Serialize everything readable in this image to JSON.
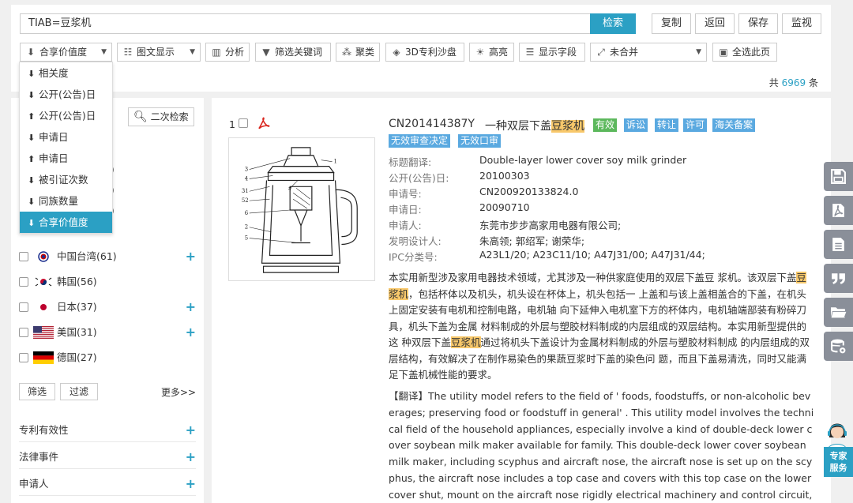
{
  "search": {
    "query": "TIAB=豆浆机",
    "button": "检索"
  },
  "top_buttons": [
    "复制",
    "返回",
    "保存",
    "监视"
  ],
  "toolbar": {
    "sort": "合享价值度",
    "display": "图文显示",
    "analyze": "分析",
    "filter_keywords": "筛选关键词",
    "cluster": "聚类",
    "sandbox": "3D专利沙盘",
    "highlight": "高亮",
    "fields": "显示字段",
    "merge": "未合并",
    "select_all": "全选此页"
  },
  "total": {
    "prefix": "共",
    "count": "6969",
    "suffix": "条"
  },
  "sort_options": [
    {
      "label": "相关度",
      "dir": "down"
    },
    {
      "label": "公开(公告)日",
      "dir": "down"
    },
    {
      "label": "公开(公告)日",
      "dir": "up"
    },
    {
      "label": "申请日",
      "dir": "down"
    },
    {
      "label": "申请日",
      "dir": "up"
    },
    {
      "label": "被引证次数",
      "dir": "down"
    },
    {
      "label": "同族数量",
      "dir": "down"
    },
    {
      "label": "合享价值度",
      "dir": "down",
      "active": true
    }
  ],
  "left": {
    "second_search": "二次检索",
    "hidden_counts": [
      ")",
      ")",
      ")"
    ],
    "countries": [
      {
        "label": "中国台湾(61)",
        "plus": true
      },
      {
        "label": "韩国(56)",
        "plus": false
      },
      {
        "label": "日本(37)",
        "plus": true
      },
      {
        "label": "美国(31)",
        "plus": true
      },
      {
        "label": "德国(27)",
        "plus": false
      }
    ],
    "filter_btn": "筛选",
    "exclude_btn": "过滤",
    "more": "更多>>",
    "sections": [
      "专利有效性",
      "法律事件",
      "申请人"
    ]
  },
  "record": {
    "index": "1",
    "pub_no": "CN201414387Y",
    "title_prefix": "一种双层下盖",
    "title_hl": "豆浆机",
    "tags_row1": [
      "有效",
      "诉讼",
      "转让",
      "许可",
      "海关备案"
    ],
    "tags_row2": [
      "无效审查决定",
      "无效口审"
    ],
    "fields": [
      {
        "label": "标题翻译:",
        "value": "Double-layer lower cover soy milk grinder"
      },
      {
        "label": "公开(公告)日:",
        "value": "20100303"
      },
      {
        "label": "申请号:",
        "value": "CN200920133824.0"
      },
      {
        "label": "申请日:",
        "value": "20090710"
      },
      {
        "label": "申请人:",
        "value": "东莞市步步高家用电器有限公司;"
      },
      {
        "label": "发明设计人:",
        "value": "朱高领; 郭绍军; 谢荣华;"
      },
      {
        "label": "IPC分类号:",
        "value": "A23L1/20; A23C11/10; A47J31/00; A47J31/44;"
      }
    ],
    "abstract_parts": [
      "本实用新型涉及家用电器技术领域，尤其涉及一种供家庭使用的双层下盖豆 浆机。该双层下盖",
      "豆浆机",
      "，包括杯体以及机头，机头设在杯体上，机头包括一 上盖和与该上盖相盖合的下盖，在机头上固定安装有电机和控制电路，电机轴 向下延伸入电机室下方的杯体内，电机轴端部装有粉碎刀具，机头下盖为金属 材料制成的外层与塑胶材料制成的内层组成的双层结构。本实用新型提供的这 种双层下盖",
      "豆浆机",
      "通过将机头下盖设计为金属材料制成的外层与塑胶材料制成 的内层组成的双层结构，有效解决了在制作易染色的果蔬豆浆时下盖的染色问 题，而且下盖易清洗，同时又能满足下盖机械性能的要求。"
    ],
    "translation": "【翻译】The utility model refers to the field of ' foods, foodstuffs, or non-alcoholic beverages; preserving food or foodstuff in general' . This utility model involves the technical field of the household appliances, especially involve a kind of double-deck lower cover soybean milk maker available for family. This double-deck lower cover soybean milk maker, including scyphus and aircraft nose, the aircraft nose is set up on the scyphus, the aircraft nose includes a top case and covers with this top case on the lower cover shut, mount on the aircraft nose rigidly electrical machinery and control circuit, electrical machinery lay, extend electrical"
  },
  "diagram_numbers": [
    "1",
    "3",
    "4",
    "31",
    "52",
    "6",
    "2",
    "5",
    "7"
  ],
  "expert": {
    "line1": "专家",
    "line2": "服务"
  },
  "colors": {
    "accent": "#2ba0c4",
    "highlight": "#f8c86b",
    "tag_green": "#5cb85c",
    "tag_blue": "#5aa9e0"
  }
}
